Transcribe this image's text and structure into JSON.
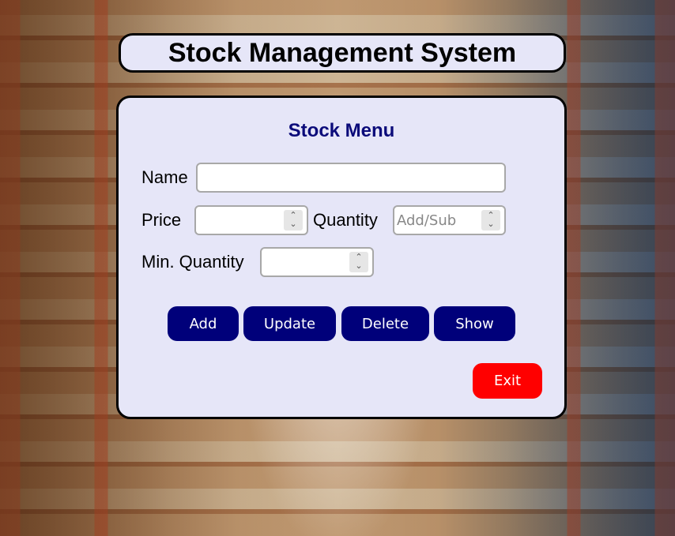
{
  "app": {
    "title": "Stock Management System"
  },
  "menu": {
    "title": "Stock Menu",
    "labels": {
      "name": "Name",
      "price": "Price",
      "quantity": "Quantity",
      "min_quantity": "Min. Quantity"
    },
    "fields": {
      "name": {
        "value": "",
        "placeholder": ""
      },
      "price": {
        "value": "",
        "placeholder": ""
      },
      "quantity": {
        "value": "",
        "placeholder": "Add/Sub"
      },
      "min_quantity": {
        "value": "",
        "placeholder": ""
      }
    },
    "buttons": {
      "add": "Add",
      "update": "Update",
      "delete": "Delete",
      "show": "Show",
      "exit": "Exit"
    }
  },
  "colors": {
    "panel_bg": "#e6e6f8",
    "button_bg": "#00007a",
    "exit_bg": "#ff0000",
    "menu_title": "#0b0b7a"
  },
  "icons": {
    "spinner": "chevron-up-down-icon"
  }
}
